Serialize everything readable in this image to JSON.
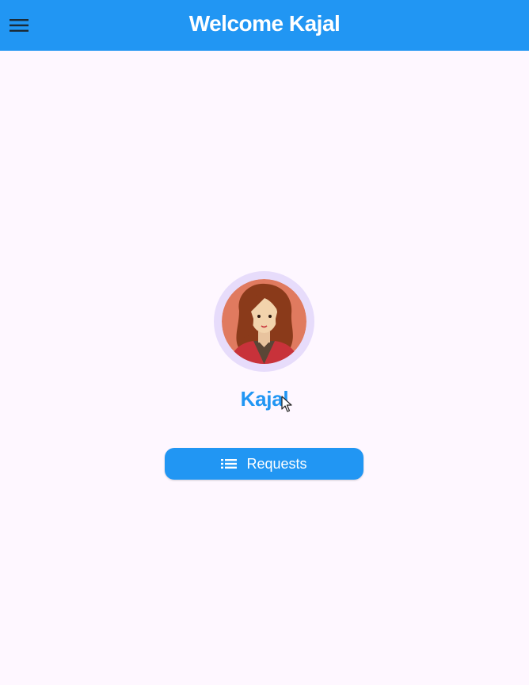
{
  "app_bar": {
    "title": "Welcome Kajal",
    "menu_icon": "hamburger-menu-icon",
    "color": "#2196F3"
  },
  "profile": {
    "name": "Kajal",
    "avatar": "female-avatar-icon",
    "name_color": "#2196F3",
    "avatar_ring_color": "#E7DCFB"
  },
  "actions": {
    "requests_label": "Requests",
    "requests_icon": "list-icon"
  },
  "theme": {
    "background": "#FEF7FF",
    "accent": "#2196F3"
  }
}
